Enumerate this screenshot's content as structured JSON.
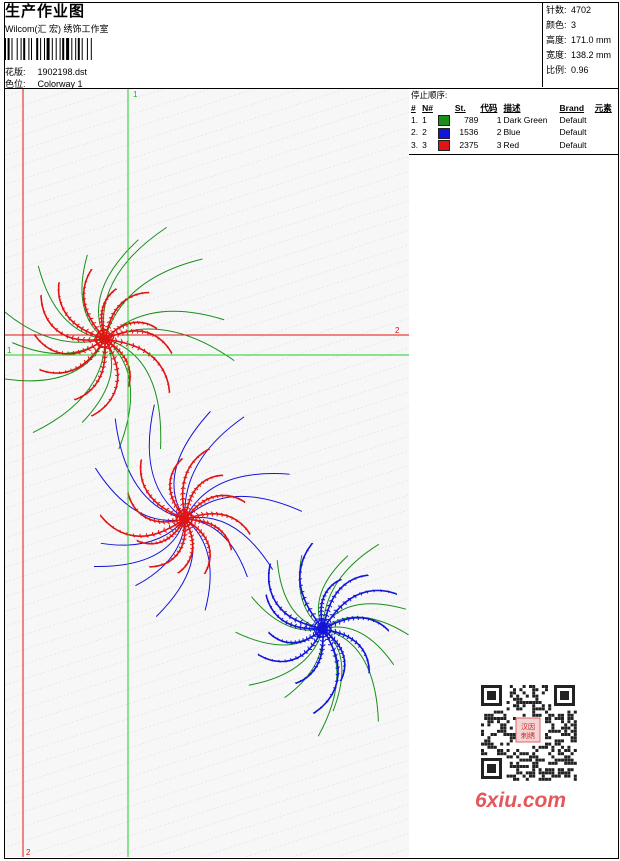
{
  "header": {
    "title": "生产作业图",
    "company": "Wilcom(汇 宏) 绣饰工作室",
    "design_label": "花版:",
    "design_value": "1902198.dst",
    "colorway_label": "色位:",
    "colorway_value": "Colorway 1"
  },
  "stats": {
    "stitches": {
      "label": "针数:",
      "value": "4702"
    },
    "colors": {
      "label": "颜色:",
      "value": "3"
    },
    "height": {
      "label": "高度:",
      "value": "171.0 mm"
    },
    "width": {
      "label": "宽度:",
      "value": "138.2 mm"
    },
    "scale": {
      "label": "比例:",
      "value": "0.96"
    }
  },
  "guides": {
    "v1_label": "1",
    "v2_label": "2",
    "h1_label": "1",
    "h2_label": "2"
  },
  "stop_sequence": {
    "title": "停止顺序:",
    "columns": [
      "#",
      "N#",
      "St.",
      "代码",
      "描述",
      "Brand",
      "元素"
    ],
    "rows": [
      {
        "index": "1.",
        "n": "1",
        "color": "#1a8f1a",
        "stitches": "789",
        "code": "1",
        "description": "Dark Green",
        "brand": "Default"
      },
      {
        "index": "2.",
        "n": "2",
        "color": "#1414d8",
        "stitches": "1536",
        "code": "2",
        "description": "Blue",
        "brand": "Default"
      },
      {
        "index": "3.",
        "n": "3",
        "color": "#e01414",
        "stitches": "2375",
        "code": "3",
        "description": "Red",
        "brand": "Default"
      }
    ]
  },
  "watermark": {
    "text": "6xiu.com",
    "stamp": "汉因刺绣"
  },
  "colors": {
    "green": "#1a8f1a",
    "blue": "#1414d8",
    "red": "#e01414",
    "guide_red": "#e01414",
    "guide_green": "#22cc22"
  }
}
